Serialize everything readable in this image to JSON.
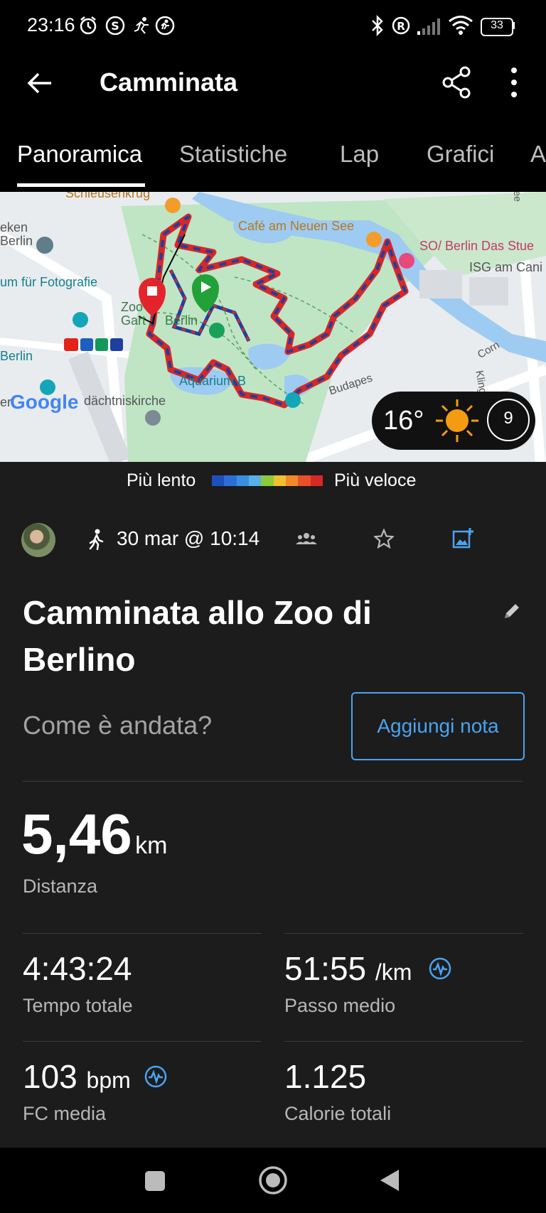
{
  "status_bar": {
    "time": "23:16",
    "battery": "33",
    "icons": [
      "alarm-icon",
      "shazam-icon",
      "running-icon",
      "activity-icon",
      "bluetooth-icon",
      "roaming-icon",
      "signal-icon",
      "wifi-icon",
      "battery-icon"
    ]
  },
  "app_bar": {
    "title": "Camminata",
    "icons": [
      "back-arrow-icon",
      "share-icon",
      "more-vert-icon"
    ]
  },
  "tabs": [
    {
      "label": "Panoramica",
      "active": true
    },
    {
      "label": "Statistiche",
      "active": false
    },
    {
      "label": "Lap",
      "active": false
    },
    {
      "label": "Grafici",
      "active": false
    },
    {
      "label": "A",
      "active": false
    }
  ],
  "map": {
    "labels": {
      "schleusenkrug": "Schleusenkrug",
      "cafe": "Café am Neuen See",
      "hotel": "SO/ Berlin Das Stue",
      "isg": "ISG am Cani",
      "museum1": "eken",
      "museum2": "Berlin",
      "fotografie": "um für Fotografie",
      "zoo1": "Zoo",
      "zoo2": "Gart",
      "zoo3": "Berlin",
      "berlin_station": "Berlin",
      "aquarium": "Aquarium B",
      "budapest": "Budapes",
      "kirche": "dächtniskirche",
      "google": "Google",
      "google_prefix": "er",
      "klingel": "Klingelhöferstr",
      "corn": "Corn",
      "street_left": "ee"
    },
    "weather": {
      "temperature": "16°",
      "wind": "9",
      "icon": "sun-icon"
    },
    "pace_colors": [
      "#1f4fbf",
      "#2b6fd6",
      "#3a8fe0",
      "#58b0e8",
      "#8ccb3a",
      "#f0c030",
      "#f08a28",
      "#e8502a",
      "#d92828"
    ]
  },
  "pace_legend": {
    "slow": "Più lento",
    "fast": "Più veloce"
  },
  "activity": {
    "date": "30 mar @ 10:14",
    "title_line1": "Camminata  allo Zoo di",
    "title_line2": "Berlino",
    "prompt": "Come è andata?",
    "add_note": "Aggiungi nota"
  },
  "stats": {
    "distance": {
      "value": "5,46",
      "unit": "km",
      "label": "Distanza"
    },
    "total_time": {
      "value": "4:43:24",
      "label": "Tempo totale"
    },
    "avg_pace": {
      "value": "51:55",
      "unit": "/km",
      "label": "Passo medio"
    },
    "avg_hr": {
      "value": "103",
      "unit": "bpm",
      "label": "FC media"
    },
    "calories": {
      "value": "1.125",
      "label": "Calorie totali"
    }
  },
  "colors": {
    "accent": "#4aa3f0",
    "background": "#1c1c1c",
    "bar": "#000000"
  }
}
